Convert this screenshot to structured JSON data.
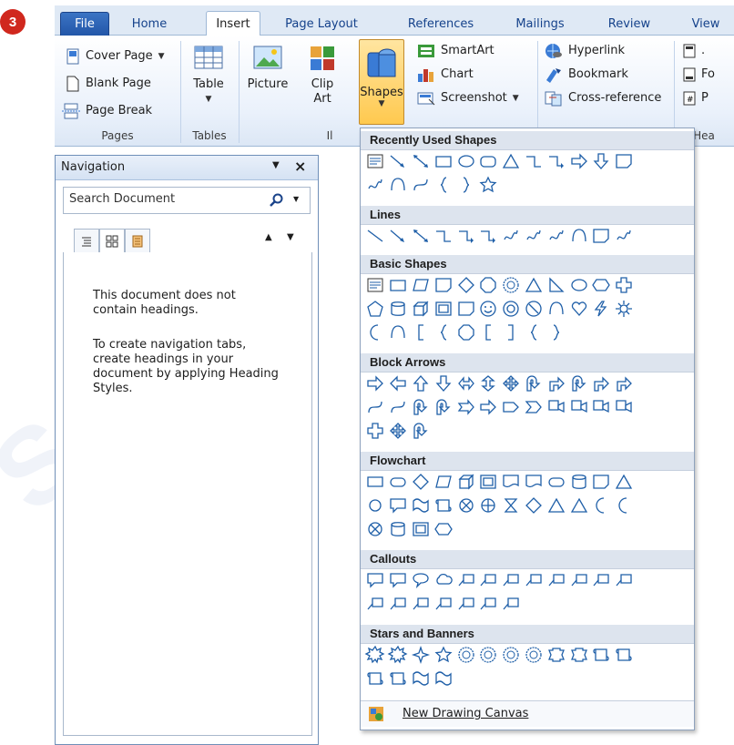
{
  "step_badge": "3",
  "tabs": [
    {
      "label": "File",
      "kind": "file"
    },
    {
      "label": "Home",
      "kind": "normal"
    },
    {
      "label": "Insert",
      "kind": "active"
    },
    {
      "label": "Page Layout",
      "kind": "normal"
    },
    {
      "label": "References",
      "kind": "normal"
    },
    {
      "label": "Mailings",
      "kind": "normal"
    },
    {
      "label": "Review",
      "kind": "normal"
    },
    {
      "label": "View",
      "kind": "normal"
    }
  ],
  "ribbon": {
    "pages": {
      "cover_page": "Cover Page",
      "blank_page": "Blank Page",
      "page_break": "Page Break",
      "label": "Pages"
    },
    "tables": {
      "table": "Table",
      "label": "Tables"
    },
    "illustrations": {
      "picture": "Picture",
      "clip_art_1": "Clip",
      "clip_art_2": "Art",
      "shapes": "Shapes",
      "smartart": "SmartArt",
      "chart": "Chart",
      "screenshot": "Screenshot",
      "label": "Il"
    },
    "links": {
      "hyperlink": "Hyperlink",
      "bookmark": "Bookmark",
      "cross_reference": "Cross-reference"
    },
    "header_footer": {
      "item1": ".",
      "item2": "Fo",
      "item3": "P",
      "label": "Hea"
    }
  },
  "navigation": {
    "title": "Navigation",
    "search_placeholder": "Search Document",
    "message_1": "This document does not contain headings.",
    "message_2": "To create navigation tabs, create headings in your document by applying Heading Styles."
  },
  "gallery": {
    "sections": [
      {
        "title": "Recently Used Shapes"
      },
      {
        "title": "Lines"
      },
      {
        "title": "Basic Shapes"
      },
      {
        "title": "Block Arrows"
      },
      {
        "title": "Flowchart"
      },
      {
        "title": "Callouts"
      },
      {
        "title": "Stars and Banners"
      }
    ],
    "new_drawing_canvas": "New Drawing Canvas"
  },
  "colors": {
    "accent": "#15428b",
    "highlight": "#ffc94f",
    "badge": "#d0281e",
    "icon_blue": "#1f5fa8"
  }
}
